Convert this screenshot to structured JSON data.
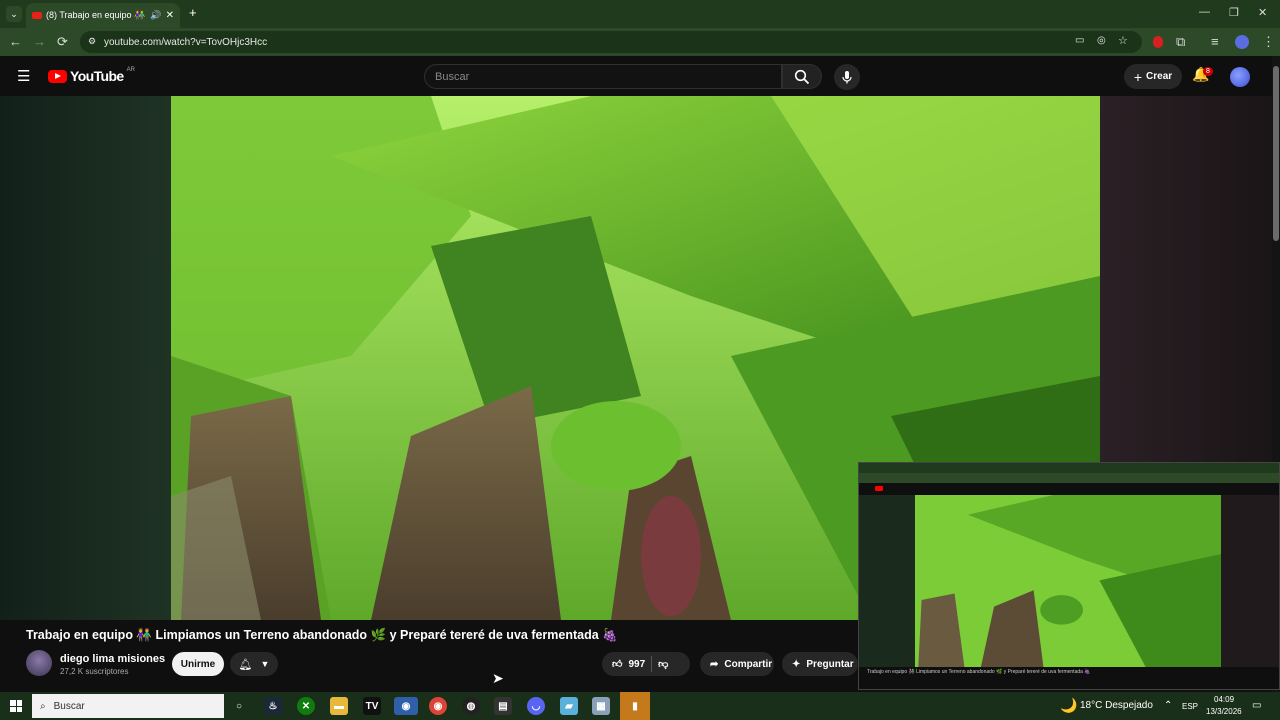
{
  "browser": {
    "tab_title": "(8) Trabajo en equipo 👫",
    "url": "youtube.com/watch?v=TovOHjc3Hcc",
    "new_tab": "+"
  },
  "youtube": {
    "logo_text": "YouTube",
    "country_code": "AR",
    "search_placeholder": "Buscar",
    "create_label": "Crear",
    "notification_count": "8"
  },
  "video": {
    "title": "Trabajo en equipo 👫 Limpiamos un Terreno abandonado 🌿 y Preparé tereré de uva fermentada 🍇",
    "channel_name": "diego lima misiones",
    "subscribers": "27,2 K suscriptores",
    "join_label": "Unirme",
    "likes": "997",
    "share_label": "Compartir",
    "ask_label": "Preguntar"
  },
  "taskbar": {
    "search_placeholder": "Buscar",
    "weather": "18°C Despejado",
    "language": "ESP",
    "time": "04:09",
    "date": "13/3/2026"
  },
  "colors": {
    "tab_strip": "#1f3a1c",
    "toolbar": "#2c4a27",
    "youtube_red": "#ff0000",
    "youtube_bg": "#0f0f0f"
  }
}
